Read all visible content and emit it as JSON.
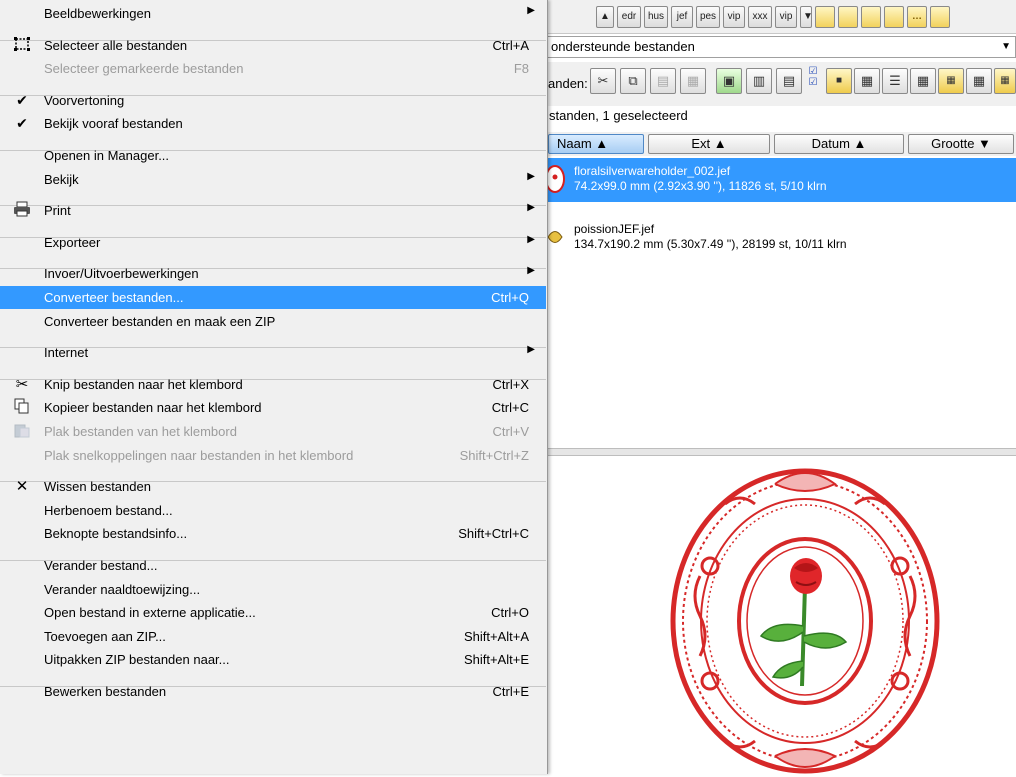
{
  "format_buttons": [
    "▲",
    "edr",
    "hus",
    "jef",
    "pes",
    "vip",
    "xxx",
    "vip",
    "▼",
    "",
    "",
    "",
    "",
    "…",
    ""
  ],
  "filter": {
    "value": "ondersteunde bestanden"
  },
  "toolbar": {
    "label": "anden:"
  },
  "count_line": "standen, 1 geselecteerd",
  "columns": [
    {
      "label": "Naam ▲"
    },
    {
      "label": "Ext ▲"
    },
    {
      "label": "Datum ▲"
    },
    {
      "label": "Grootte ▼"
    }
  ],
  "files": [
    {
      "name": "floralsilverwareholder_002.jef",
      "info": "74.2x99.0 mm (2.92x3.90 ''), 11826 st, 5/10 klrn",
      "selected": true
    },
    {
      "name": "poissionJEF.jef",
      "info": "134.7x190.2 mm (5.30x7.49 ''), 28199 st, 10/11 klrn",
      "selected": false
    }
  ],
  "menu": [
    {
      "label": "Beeldbewerkingen",
      "submenu": true
    },
    {
      "sep": true
    },
    {
      "label": "Selecteer alle bestanden",
      "shortcut": "Ctrl+A",
      "icon": "select-all-icon"
    },
    {
      "label": "Selecteer gemarkeerde bestanden",
      "shortcut": "F8",
      "disabled": true
    },
    {
      "sep": true
    },
    {
      "label": "Voorvertoning",
      "icon": "checkmark-icon"
    },
    {
      "label": "Bekijk vooraf bestanden",
      "icon": "checkmark-icon"
    },
    {
      "sep": true
    },
    {
      "label": "Openen in Manager..."
    },
    {
      "label": "Bekijk",
      "submenu": true
    },
    {
      "sep": true
    },
    {
      "label": "Print",
      "submenu": true,
      "icon": "printer-icon"
    },
    {
      "sep": true
    },
    {
      "label": "Exporteer",
      "submenu": true
    },
    {
      "sep": true
    },
    {
      "label": "Invoer/Uitvoerbewerkingen",
      "submenu": true
    },
    {
      "label": "Converteer bestanden...",
      "shortcut": "Ctrl+Q",
      "highlighted": true
    },
    {
      "label": "Converteer bestanden en maak een ZIP"
    },
    {
      "sep": true
    },
    {
      "label": "Internet",
      "submenu": true
    },
    {
      "sep": true
    },
    {
      "label": "Knip bestanden naar het klembord",
      "shortcut": "Ctrl+X",
      "icon": "scissors-icon"
    },
    {
      "label": "Kopieer bestanden naar het klembord",
      "shortcut": "Ctrl+C",
      "icon": "copy-icon"
    },
    {
      "label": "Plak bestanden van het klembord",
      "shortcut": "Ctrl+V",
      "icon": "paste-icon",
      "disabled": true
    },
    {
      "label": "Plak snelkoppelingen naar bestanden in het klembord",
      "shortcut": "Shift+Ctrl+Z",
      "disabled": true
    },
    {
      "sep": true
    },
    {
      "label": "Wissen bestanden",
      "icon": "delete-x-icon"
    },
    {
      "label": "Herbenoem bestand..."
    },
    {
      "label": "Beknopte bestandsinfo...",
      "shortcut": "Shift+Ctrl+C"
    },
    {
      "sep": true
    },
    {
      "label": "Verander bestand..."
    },
    {
      "label": "Verander naaldtoewijzing..."
    },
    {
      "label": "Open bestand in externe applicatie...",
      "shortcut": "Ctrl+O"
    },
    {
      "label": "Toevoegen aan ZIP...",
      "shortcut": "Shift+Alt+A"
    },
    {
      "label": "Uitpakken ZIP bestanden naar...",
      "shortcut": "Shift+Alt+E"
    },
    {
      "sep": true
    },
    {
      "label": "Bewerken bestanden",
      "shortcut": "Ctrl+E"
    }
  ]
}
